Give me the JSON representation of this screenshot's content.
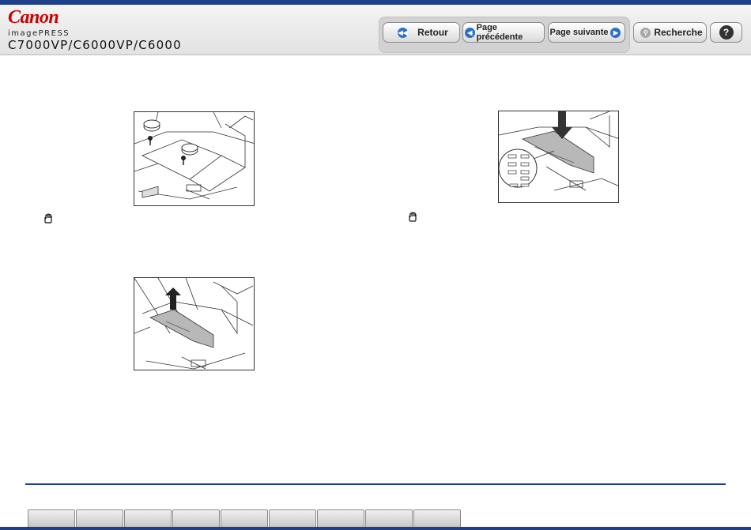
{
  "header": {
    "brand": "Canon",
    "product_line": "imagePRESS",
    "model": "C7000VP/C6000VP/C6000"
  },
  "nav": {
    "back_label": "Retour",
    "prev_label": "Page précédente",
    "next_label": "Page suivante",
    "search_label": "Recherche",
    "help_label": "?"
  },
  "tabs": [
    "",
    "",
    "",
    "",
    "",
    "",
    "",
    "",
    ""
  ],
  "colors": {
    "accent": "#1e3f8a",
    "nav_icon": "#2d6fc4",
    "brand": "#d00000"
  }
}
